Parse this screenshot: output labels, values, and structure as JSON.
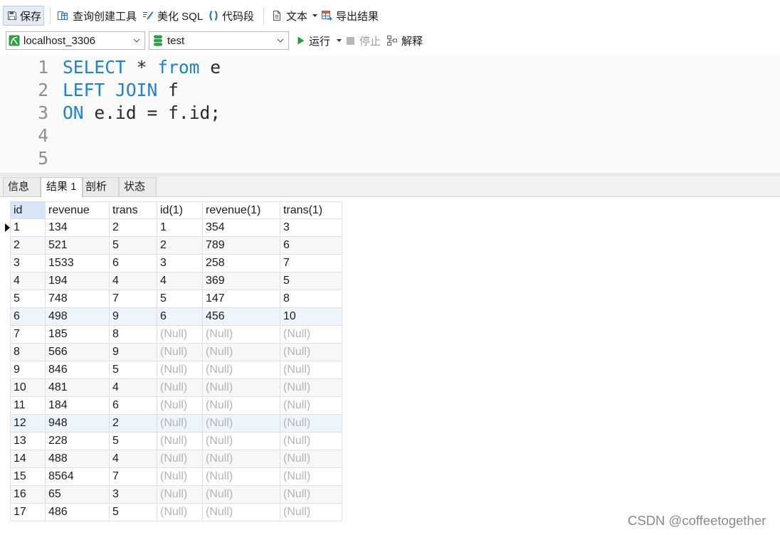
{
  "toolbar": {
    "save": {
      "label": "保存",
      "icon": "floppy-disk-icon"
    },
    "query_builder": {
      "label": "查询创建工具",
      "icon": "query-builder-icon"
    },
    "beautify_sql": {
      "label": "美化 SQL",
      "icon": "beautify-sql-icon"
    },
    "code_snippet": {
      "label": "代码段",
      "icon": "parentheses-icon"
    },
    "text": {
      "label": "文本",
      "icon": "document-icon"
    },
    "export_results": {
      "label": "导出结果",
      "icon": "export-table-icon"
    }
  },
  "query_bar": {
    "connection": {
      "value": "localhost_3306",
      "icon": "mysql-connection-icon"
    },
    "database": {
      "value": "test",
      "icon": "database-icon"
    },
    "run": {
      "label": "运行",
      "icon": "play-icon"
    },
    "stop": {
      "label": "停止",
      "icon": "stop-icon",
      "enabled": false
    },
    "explain": {
      "label": "解释",
      "icon": "explain-icon"
    }
  },
  "editor": {
    "lines": [
      {
        "number": "1",
        "tokens": [
          {
            "text": "SELECT",
            "keyword": true
          },
          {
            "text": " * ",
            "keyword": false
          },
          {
            "text": "from",
            "keyword": true
          },
          {
            "text": " e",
            "keyword": false
          }
        ]
      },
      {
        "number": "2",
        "tokens": [
          {
            "text": "LEFT JOIN",
            "keyword": true
          },
          {
            "text": " f",
            "keyword": false
          }
        ]
      },
      {
        "number": "3",
        "tokens": [
          {
            "text": "ON",
            "keyword": true
          },
          {
            "text": " e.id = f.id;",
            "keyword": false
          }
        ]
      },
      {
        "number": "4",
        "tokens": []
      },
      {
        "number": "5",
        "tokens": []
      }
    ]
  },
  "result_tabs": {
    "tabs": [
      {
        "label": "信息",
        "active": false
      },
      {
        "label": "结果 1",
        "active": true
      },
      {
        "label": "剖析",
        "active": false
      },
      {
        "label": "状态",
        "active": false
      }
    ]
  },
  "results": {
    "columns": [
      "id",
      "revenue",
      "trans",
      "id(1)",
      "revenue(1)",
      "trans(1)"
    ],
    "rows": [
      [
        "1",
        "134",
        "2",
        "1",
        "354",
        "3"
      ],
      [
        "2",
        "521",
        "5",
        "2",
        "789",
        "6"
      ],
      [
        "3",
        "1533",
        "6",
        "3",
        "258",
        "7"
      ],
      [
        "4",
        "194",
        "4",
        "4",
        "369",
        "5"
      ],
      [
        "5",
        "748",
        "7",
        "5",
        "147",
        "8"
      ],
      [
        "6",
        "498",
        "9",
        "6",
        "456",
        "10"
      ],
      [
        "7",
        "185",
        "8",
        "(Null)",
        "(Null)",
        "(Null)"
      ],
      [
        "8",
        "566",
        "9",
        "(Null)",
        "(Null)",
        "(Null)"
      ],
      [
        "9",
        "846",
        "5",
        "(Null)",
        "(Null)",
        "(Null)"
      ],
      [
        "10",
        "481",
        "4",
        "(Null)",
        "(Null)",
        "(Null)"
      ],
      [
        "11",
        "184",
        "6",
        "(Null)",
        "(Null)",
        "(Null)"
      ],
      [
        "12",
        "948",
        "2",
        "(Null)",
        "(Null)",
        "(Null)"
      ],
      [
        "13",
        "228",
        "5",
        "(Null)",
        "(Null)",
        "(Null)"
      ],
      [
        "14",
        "488",
        "4",
        "(Null)",
        "(Null)",
        "(Null)"
      ],
      [
        "15",
        "8564",
        "7",
        "(Null)",
        "(Null)",
        "(Null)"
      ],
      [
        "16",
        "65",
        "3",
        "(Null)",
        "(Null)",
        "(Null)"
      ],
      [
        "17",
        "486",
        "5",
        "(Null)",
        "(Null)",
        "(Null)"
      ]
    ],
    "current_row": 1
  },
  "colors": {
    "keyword": "#1e80d8",
    "null_text": "#b4b4b4",
    "run_green": "#2a9d2a",
    "connection_green": "#2ea043",
    "pressed_button": "#e2ebf6"
  },
  "watermark": "CSDN @coffeetogether"
}
